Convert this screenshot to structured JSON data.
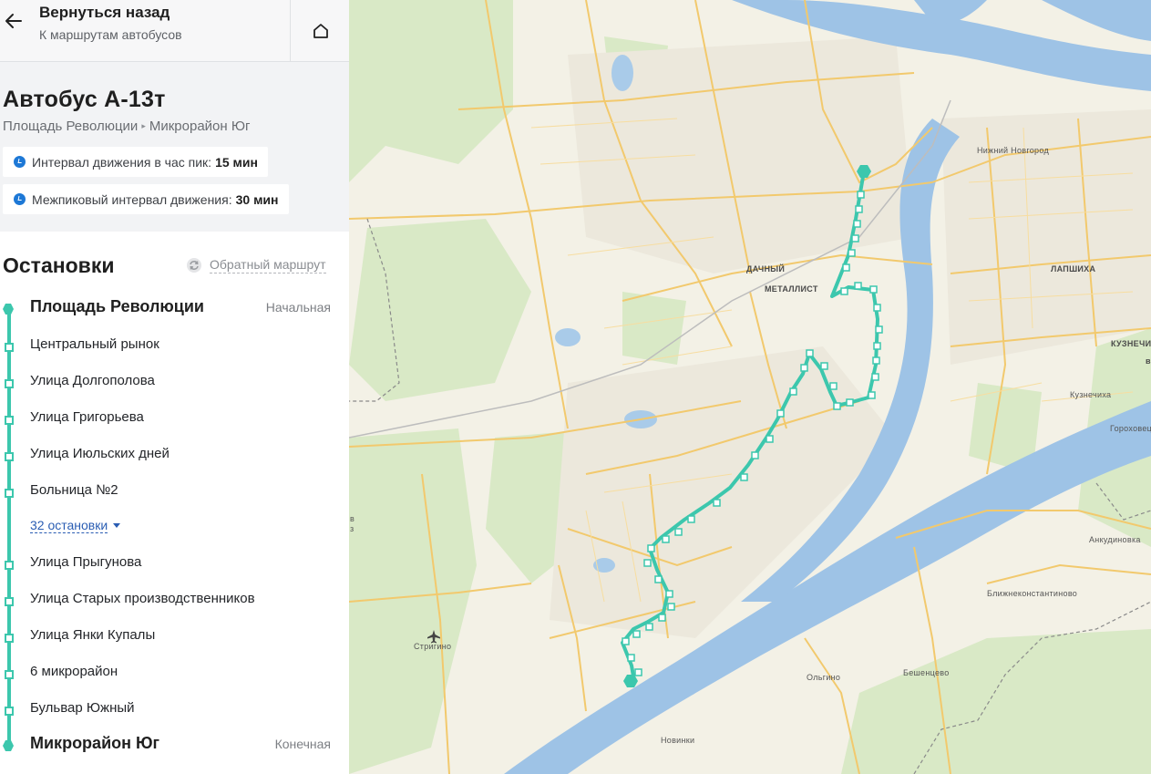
{
  "header": {
    "back_title": "Вернуться назад",
    "back_subtitle": "К маршрутам автобусов"
  },
  "route": {
    "title": "Автобус А-13т",
    "from": "Площадь Революции",
    "to": "Микрорайон Юг",
    "peak_interval_label": "Интервал движения в час пик:",
    "peak_interval_value": "15 мин",
    "offpeak_interval_label": "Межпиковый интервал движения:",
    "offpeak_interval_value": "30 мин"
  },
  "stops": {
    "heading": "Остановки",
    "reverse_label": "Обратный маршрут",
    "first": {
      "name": "Площадь Революции",
      "tag": "Начальная"
    },
    "items_before": [
      "Центральный рынок",
      "Улица Долгополова",
      "Улица Григорьева",
      "Улица Июльских дней",
      "Больница №2"
    ],
    "more_label": "32 остановки",
    "items_after": [
      "Улица Прыгунова",
      "Улица Старых производственников",
      "Улица Янки Купалы",
      "6 микрорайон",
      "Бульвар Южный"
    ],
    "last": {
      "name": "Микрорайон Юг",
      "tag": "Конечная"
    }
  },
  "map": {
    "labels": {
      "nizhny": "Нижний Новгород",
      "dachny": "ДАЧНЫЙ",
      "metallist": "МЕТАЛЛИСТ",
      "lapshikha": "ЛАПШИХА",
      "kuznechikha_upper": "КУЗНЕЧИ",
      "kuznechikha": "Кузнечиха",
      "gorokhovets": "Гороховец",
      "ankudinovka": "Анкудиновка",
      "blizhnekonst": "Ближнеконстантиново",
      "strigino": "Стригино",
      "olgino": "Ольгино",
      "beshentsevo": "Бешенцево",
      "novinki": "Новинки",
      "edge_b": "в",
      "edge_v": "в",
      "edge_z": "з"
    },
    "colors": {
      "route": "#3cc7ad",
      "water": "#9ec3e6",
      "land": "#f3f1e6",
      "green": "#d8e8c4",
      "road": "#f2c96d"
    }
  }
}
